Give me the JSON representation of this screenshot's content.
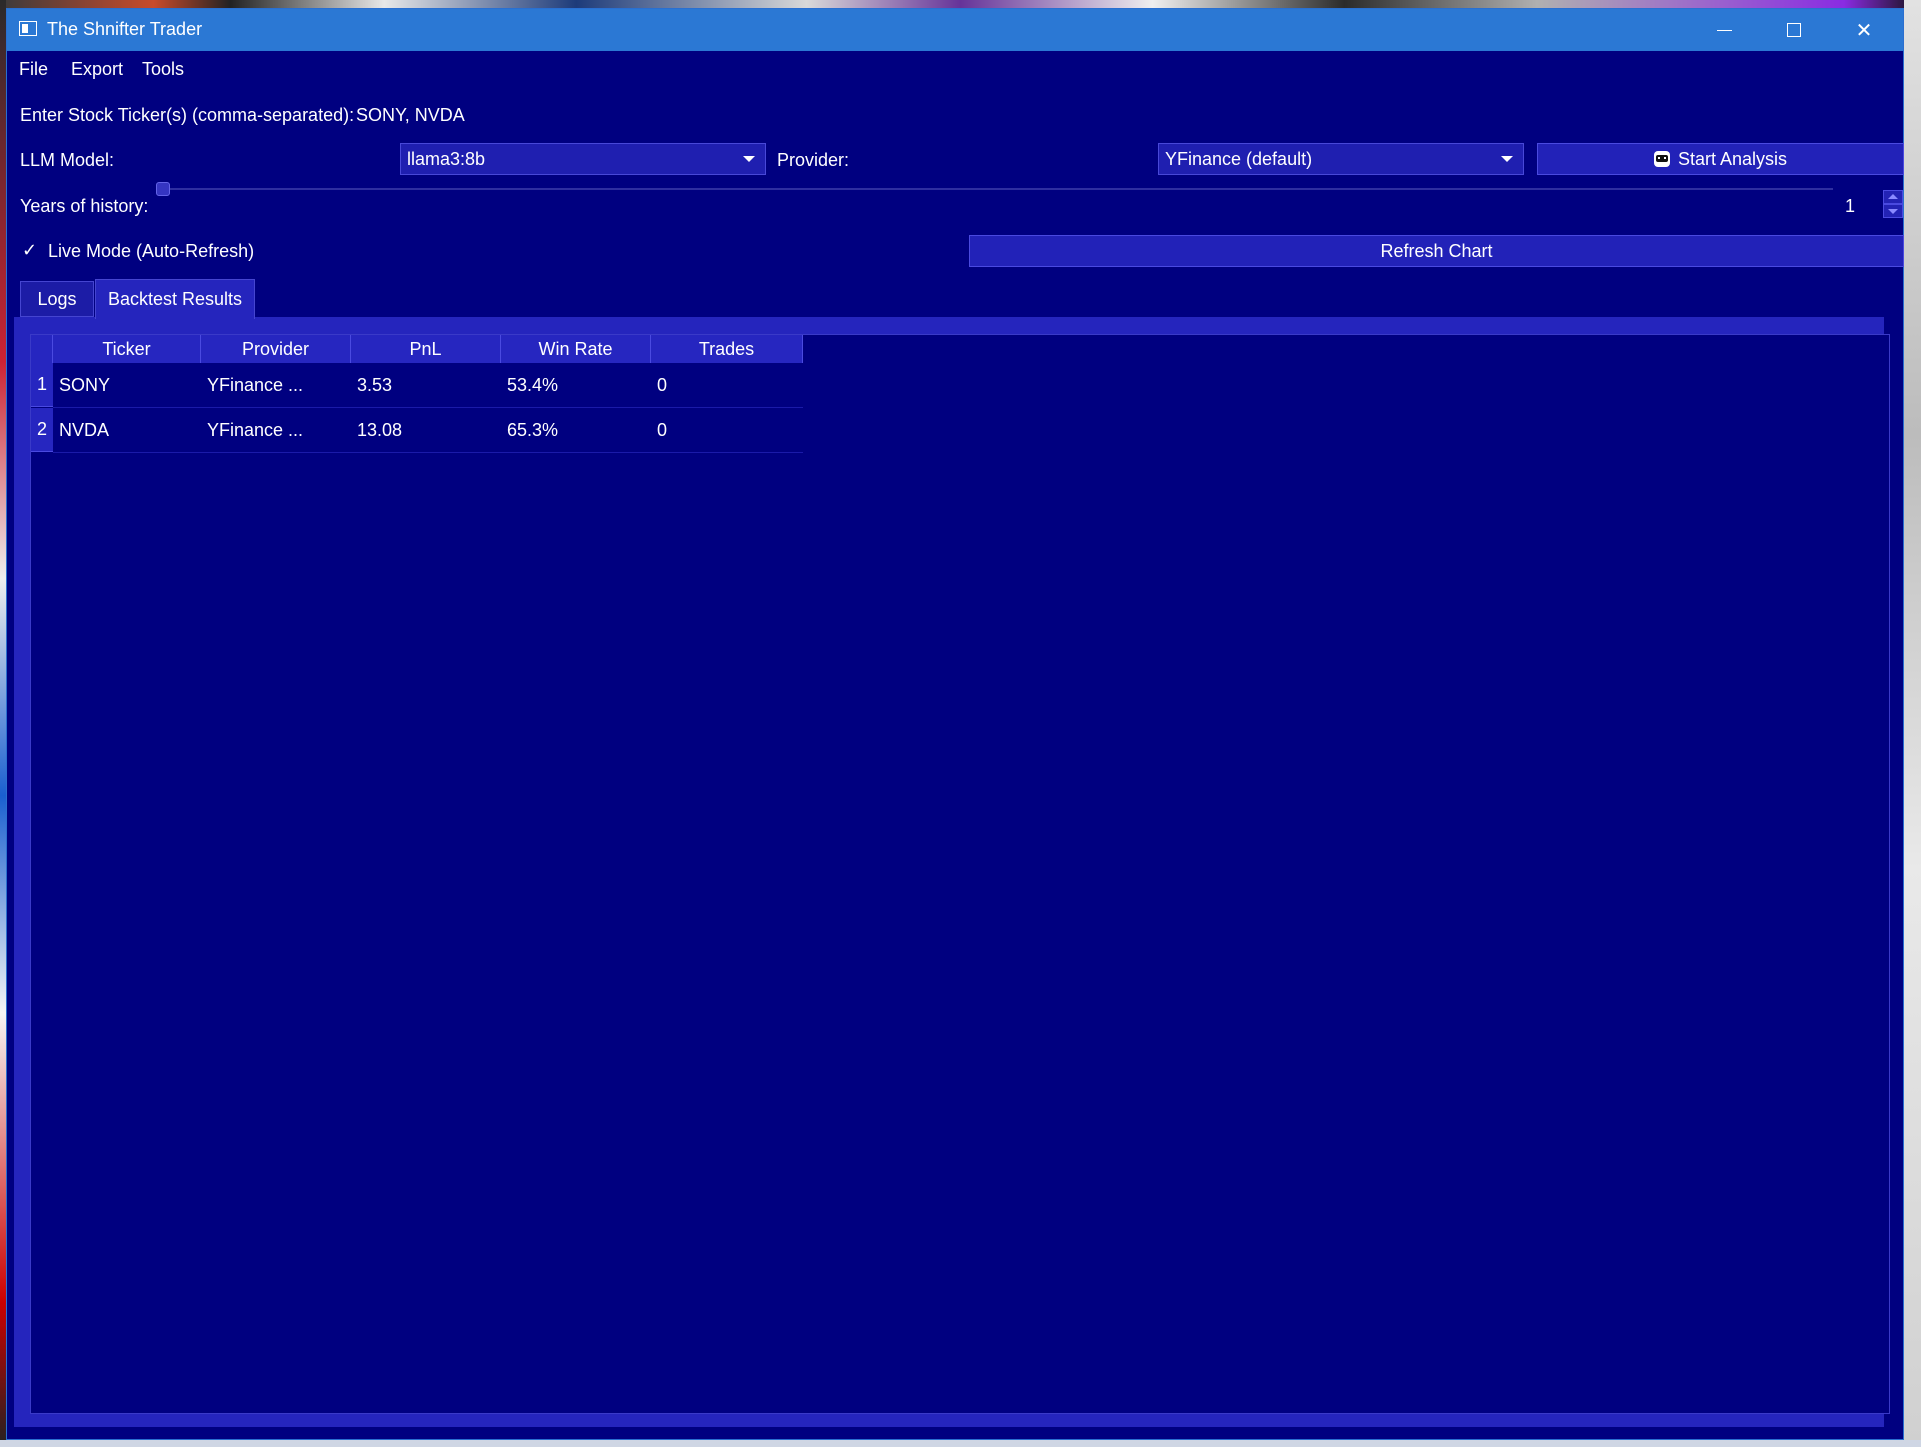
{
  "window": {
    "title": "The Shnifter Trader"
  },
  "menu": {
    "items": [
      "File",
      "Export",
      "Tools"
    ]
  },
  "form": {
    "ticker_label": "Enter Stock Ticker(s) (comma-separated):",
    "ticker_value": "SONY, NVDA",
    "llm_label": "LLM Model:",
    "llm_value": "llama3:8b",
    "provider_label": "Provider:",
    "provider_value": "YFinance (default)",
    "start_button": "Start Analysis",
    "years_label": "Years of history:",
    "years_value": "1",
    "live_mode_label": "Live Mode (Auto-Refresh)",
    "live_mode_checked": true,
    "refresh_button": "Refresh Chart"
  },
  "tabs": {
    "items": [
      "Logs",
      "Backtest Results"
    ],
    "active": "Backtest Results"
  },
  "table": {
    "headers": [
      "Ticker",
      "Provider",
      "PnL",
      "Win Rate",
      "Trades"
    ],
    "rows": [
      {
        "num": "1",
        "ticker": "SONY",
        "provider": "YFinance ...",
        "pnl": "3.53",
        "win_rate": "53.4%",
        "trades": "0"
      },
      {
        "num": "2",
        "ticker": "NVDA",
        "provider": "YFinance ...",
        "pnl": "13.08",
        "win_rate": "65.3%",
        "trades": "0"
      }
    ]
  },
  "colors": {
    "window_bg": "#000080",
    "titlebar": "#2b78d4",
    "control_bg": "#2525bd"
  }
}
